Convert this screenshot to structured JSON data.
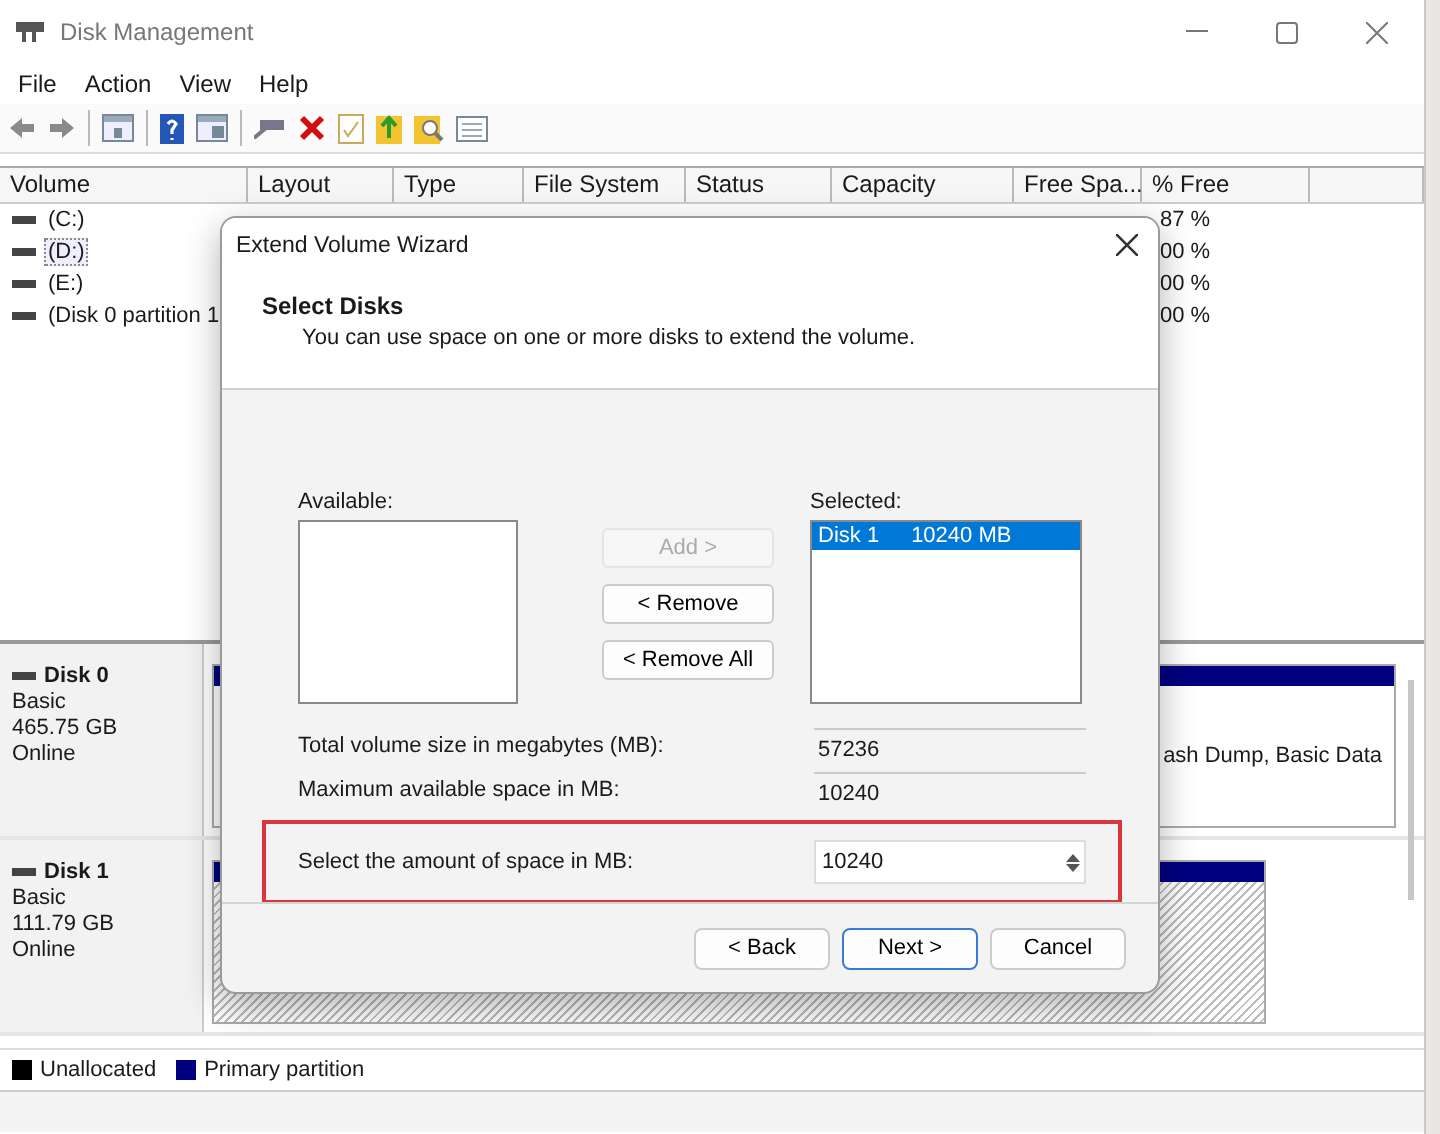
{
  "window": {
    "title": "Disk Management"
  },
  "menu": [
    {
      "label": "File"
    },
    {
      "label": "Action"
    },
    {
      "label": "View"
    },
    {
      "label": "Help"
    }
  ],
  "volume_table": {
    "columns": [
      "Volume",
      "Layout",
      "Type",
      "File System",
      "Status",
      "Capacity",
      "Free Spa...",
      "% Free"
    ],
    "rows": [
      {
        "volume": "(C:)",
        "percent_free": "87 %",
        "focused": false
      },
      {
        "volume": "(D:)",
        "percent_free": "00 %",
        "focused": true
      },
      {
        "volume": "(E:)",
        "percent_free": "00 %",
        "focused": false
      },
      {
        "volume": "(Disk 0 partition 1",
        "percent_free": "00 %",
        "focused": false
      }
    ]
  },
  "disks": [
    {
      "name": "Disk 0",
      "type": "Basic",
      "size": "465.75 GB",
      "status": "Online",
      "partition_text": "ash Dump, Basic Data",
      "kind": "labeled"
    },
    {
      "name": "Disk 1",
      "type": "Basic",
      "size": "111.79 GB",
      "status": "Online",
      "kind": "hatched"
    }
  ],
  "legend": [
    {
      "label": "Unallocated",
      "color": "#000000"
    },
    {
      "label": "Primary partition",
      "color": "#000080"
    }
  ],
  "dialog": {
    "title": "Extend Volume Wizard",
    "heading": "Select Disks",
    "subtitle": "You can use space on one or more disks to extend the volume.",
    "available_label": "Available:",
    "move_buttons": [
      {
        "label": "Add >",
        "disabled": true
      },
      {
        "label": "< Remove",
        "disabled": false
      },
      {
        "label": "< Remove All",
        "disabled": false
      }
    ],
    "selected_label": "Selected:",
    "selected_items": [
      {
        "disk": "Disk 1",
        "size": "10240 MB",
        "selected": true
      }
    ],
    "fields": [
      {
        "label": "Total volume size in megabytes (MB):",
        "value": "57236",
        "kind": "readonly",
        "highlighted": false
      },
      {
        "label": "Maximum available space in MB:",
        "value": "10240",
        "kind": "readonly",
        "highlighted": false
      },
      {
        "label": "Select the amount of space in MB:",
        "value": "10240",
        "kind": "spinner",
        "highlighted": true
      }
    ],
    "footer_buttons": [
      {
        "label": "< Back",
        "default": false
      },
      {
        "label": "Next >",
        "default": true
      },
      {
        "label": "Cancel",
        "default": false
      }
    ]
  }
}
